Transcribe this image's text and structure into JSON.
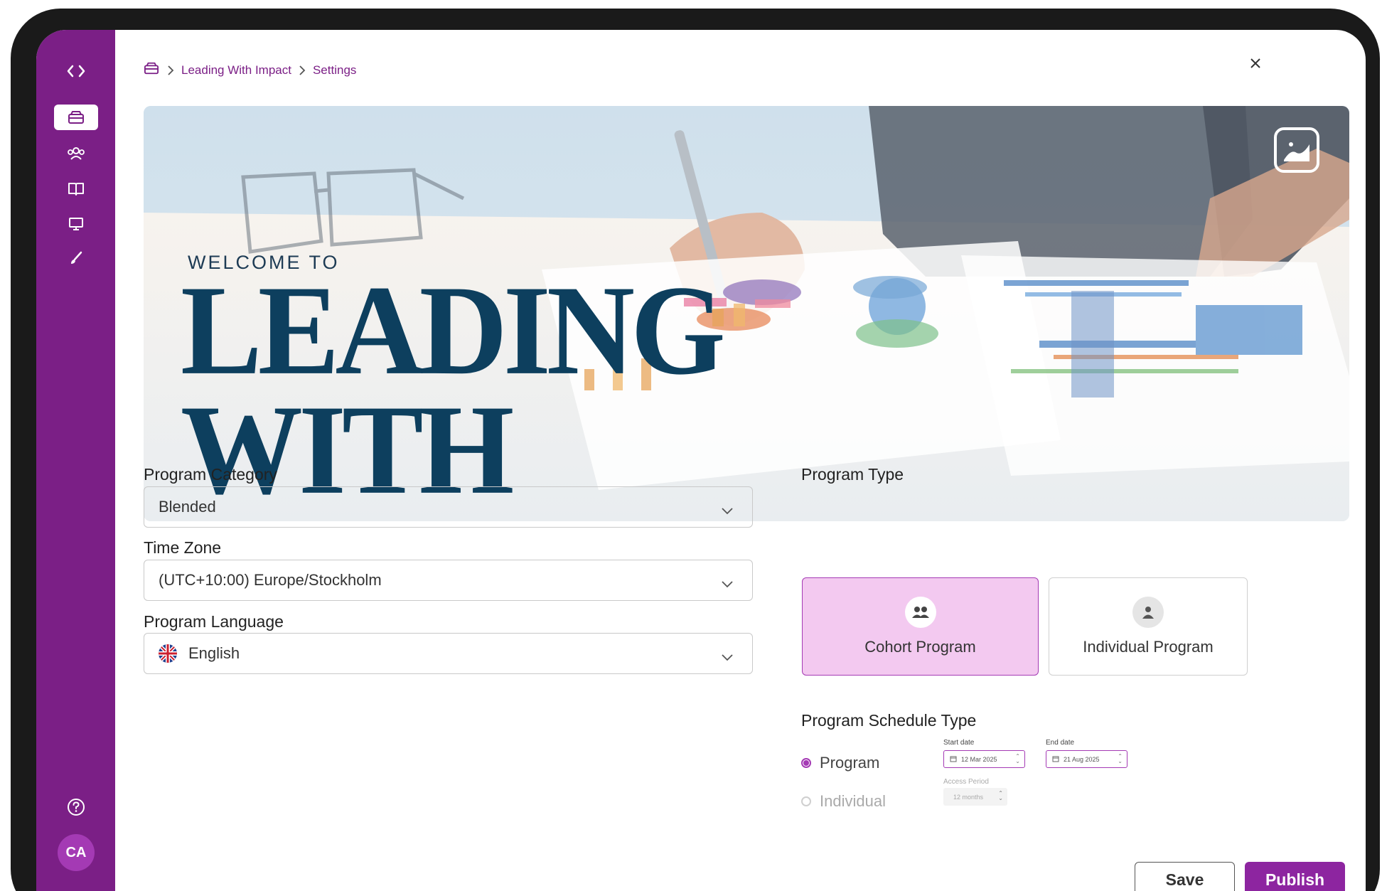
{
  "breadcrumb": {
    "items": [
      "Leading With Impact",
      "Settings"
    ]
  },
  "banner": {
    "welcome": "WELCOME TO",
    "title_line1": "LEADING",
    "title_line2": "WITH IMPACT"
  },
  "sidebar": {
    "items": [
      "code-icon",
      "program-icon",
      "people-icon",
      "book-icon",
      "monitor-icon",
      "brush-icon"
    ],
    "help_icon": "help-icon",
    "avatar_initials": "CA"
  },
  "form": {
    "category_label": "Program Category",
    "category_value": "Blended",
    "timezone_label": "Time Zone",
    "timezone_value": "(UTC+10:00) Europe/Stockholm",
    "language_label": "Program Language",
    "language_value": "English"
  },
  "program_type": {
    "label": "Program Type",
    "options": [
      "Cohort Program",
      "Individual Program"
    ],
    "selected": "Cohort Program"
  },
  "schedule": {
    "label": "Program Schedule Type",
    "options": [
      "Program",
      "Individual"
    ],
    "selected": "Program",
    "start_label": "Start date",
    "start_value": "12 Mar 2025",
    "end_label": "End date",
    "end_value": "21 Aug 2025",
    "access_label": "Access Period",
    "access_value": "12 months"
  },
  "actions": {
    "save": "Save",
    "publish": "Publish"
  },
  "colors": {
    "brand": "#7b1f86",
    "accent": "#8d25a0",
    "title_navy": "#0d3f5e"
  }
}
